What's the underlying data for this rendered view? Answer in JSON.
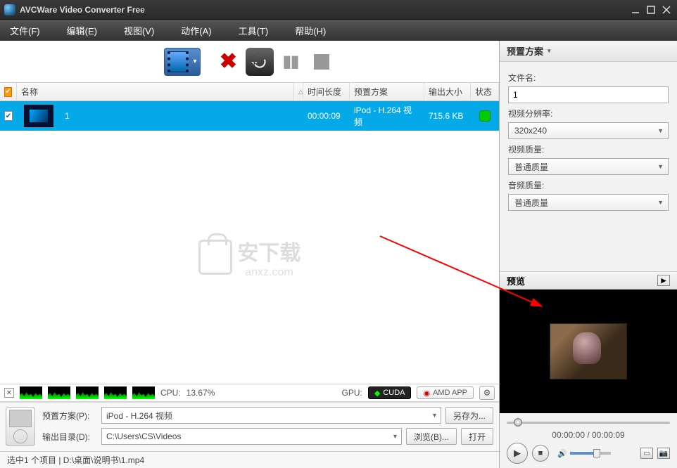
{
  "window": {
    "title": "AVCWare Video Converter Free"
  },
  "menu": {
    "file": "文件(F)",
    "edit": "编辑(E)",
    "view": "视图(V)",
    "action": "动作(A)",
    "tools": "工具(T)",
    "help": "帮助(H)"
  },
  "list": {
    "headers": {
      "name": "名称",
      "duration": "时间长度",
      "profile": "预置方案",
      "size": "输出大小",
      "status": "状态"
    },
    "row": {
      "name": "1",
      "duration": "00:00:09",
      "profile": "iPod - H.264 视频",
      "size": "715.6 KB"
    }
  },
  "watermark": {
    "brand": "安下载",
    "domain": "anxz.com"
  },
  "cpu": {
    "label": "CPU:",
    "value": "13.67%",
    "gpu_label": "GPU:",
    "cuda": "CUDA",
    "amd": "AMD APP"
  },
  "bottom": {
    "profile_label": "预置方案(P):",
    "profile_value": "iPod - H.264 视频",
    "saveas": "另存为...",
    "output_label": "输出目录(D):",
    "output_value": "C:\\Users\\CS\\Videos",
    "browse": "浏览(B)...",
    "open": "打开"
  },
  "status": "选中1 个项目 | D:\\桌面\\说明书\\1.mp4",
  "right": {
    "header": "预置方案",
    "filename_label": "文件名:",
    "filename_value": "1",
    "res_label": "视频分辨率:",
    "res_value": "320x240",
    "vq_label": "视频质量:",
    "vq_value": "普通质量",
    "aq_label": "音频质量:",
    "aq_value": "普通质量",
    "preview_label": "预览",
    "time": "00:00:00 / 00:00:09"
  }
}
